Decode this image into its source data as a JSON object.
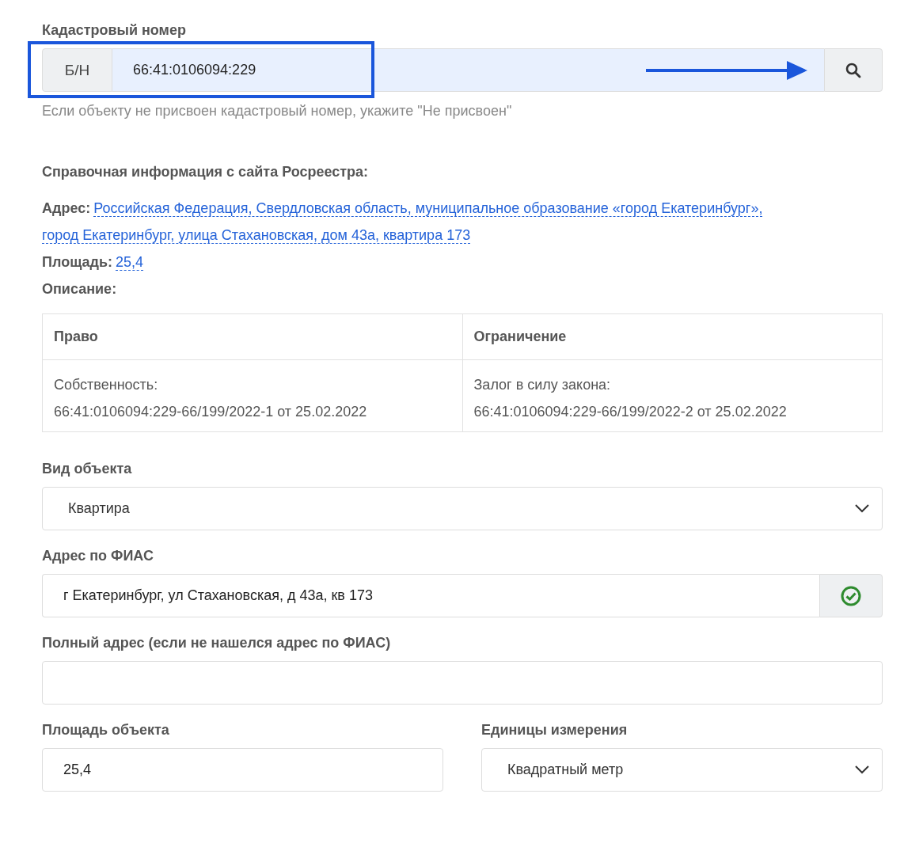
{
  "cadastral": {
    "label": "Кадастровый номер",
    "prefix": "Б/Н",
    "value": "66:41:0106094:229",
    "hint": "Если объекту не присвоен кадастровый номер, укажите \"Не присвоен\""
  },
  "rosreestr": {
    "heading": "Справочная информация с сайта Росреестра:",
    "address_label": "Адрес:",
    "address_value": [
      "Российская Федерация, Свердловская область, муниципальное образование «город Екатеринбург»,",
      "город Екатеринбург, улица Стахановская, дом 43а, квартира 173"
    ],
    "area_label": "Площадь:",
    "area_value": "25,4",
    "description_label": "Описание:"
  },
  "rights_table": {
    "columns": [
      "Право",
      "Ограничение"
    ],
    "rows": [
      [
        [
          "Собственность:",
          "66:41:0106094:229-66/199/2022-1 от 25.02.2022"
        ],
        [
          "Залог в силу закона:",
          "66:41:0106094:229-66/199/2022-2 от 25.02.2022"
        ]
      ]
    ]
  },
  "object_type": {
    "label": "Вид объекта",
    "value": "Квартира"
  },
  "fias_address": {
    "label": "Адрес по ФИАС",
    "value": "г Екатеринбург, ул Стахановская, д 43а, кв 173",
    "verified": true
  },
  "full_address": {
    "label": "Полный адрес (если не нашелся адрес по ФИАС)"
  },
  "area": {
    "label": "Площадь объекта",
    "value": "25,4"
  },
  "units": {
    "label": "Единицы измерения",
    "value": "Квадратный метр"
  }
}
